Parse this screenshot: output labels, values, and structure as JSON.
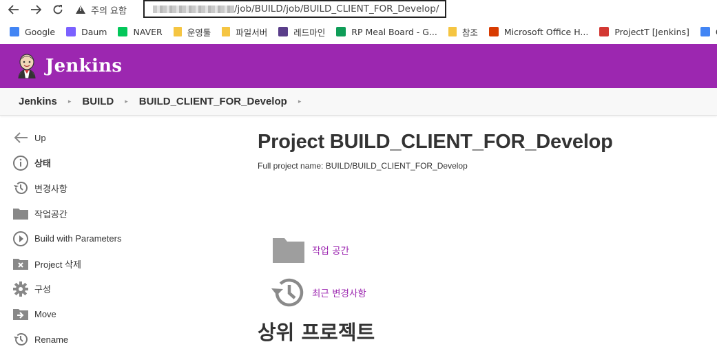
{
  "browser": {
    "security_label": "주의 요함",
    "url_path": "/job/BUILD/job/BUILD_CLIENT_FOR_Develop/",
    "bookmarks": [
      {
        "label": "Google",
        "icon": "google-icon",
        "color": "#4285f4"
      },
      {
        "label": "Daum",
        "icon": "daum-icon",
        "color": "#7b61ff"
      },
      {
        "label": "NAVER",
        "icon": "naver-icon",
        "color": "#03c75a"
      },
      {
        "label": "운영툴",
        "icon": "folder-icon",
        "color": "#f5c542"
      },
      {
        "label": "파일서버",
        "icon": "folder-icon",
        "color": "#f5c542"
      },
      {
        "label": "레드마인",
        "icon": "redmine-icon",
        "color": "#5a3e8a"
      },
      {
        "label": "RP Meal Board - G...",
        "icon": "sheets-icon",
        "color": "#0f9d58"
      },
      {
        "label": "참조",
        "icon": "folder-icon",
        "color": "#f5c542"
      },
      {
        "label": "Microsoft Office H...",
        "icon": "office-icon",
        "color": "#d83b01"
      },
      {
        "label": "ProjectT [Jenkins]",
        "icon": "jenkins-icon",
        "color": "#d33833"
      },
      {
        "label": "Goo",
        "icon": "google-translate-icon",
        "color": "#4285f4"
      }
    ]
  },
  "header": {
    "title": "Jenkins",
    "color": "#9c27b0"
  },
  "breadcrumb": [
    "Jenkins",
    "BUILD",
    "BUILD_CLIENT_FOR_Develop"
  ],
  "sidebar": {
    "items": [
      {
        "label": "Up",
        "icon": "arrow-left-icon"
      },
      {
        "label": "상태",
        "icon": "info-icon"
      },
      {
        "label": "변경사항",
        "icon": "history-icon"
      },
      {
        "label": "작업공간",
        "icon": "folder-icon"
      },
      {
        "label": "Build with Parameters",
        "icon": "play-icon"
      },
      {
        "label": "Project 삭제",
        "icon": "delete-folder-icon"
      },
      {
        "label": "구성",
        "icon": "gear-icon"
      },
      {
        "label": "Move",
        "icon": "move-icon"
      },
      {
        "label": "Rename",
        "icon": "rename-icon"
      }
    ]
  },
  "main": {
    "title": "Project BUILD_CLIENT_FOR_Develop",
    "full_name": "Full project name: BUILD/BUILD_CLIENT_FOR_Develop",
    "workspace_link": "작업 공간",
    "changes_link": "최근 변경사항",
    "upstream_heading": "상위 프로젝트"
  }
}
